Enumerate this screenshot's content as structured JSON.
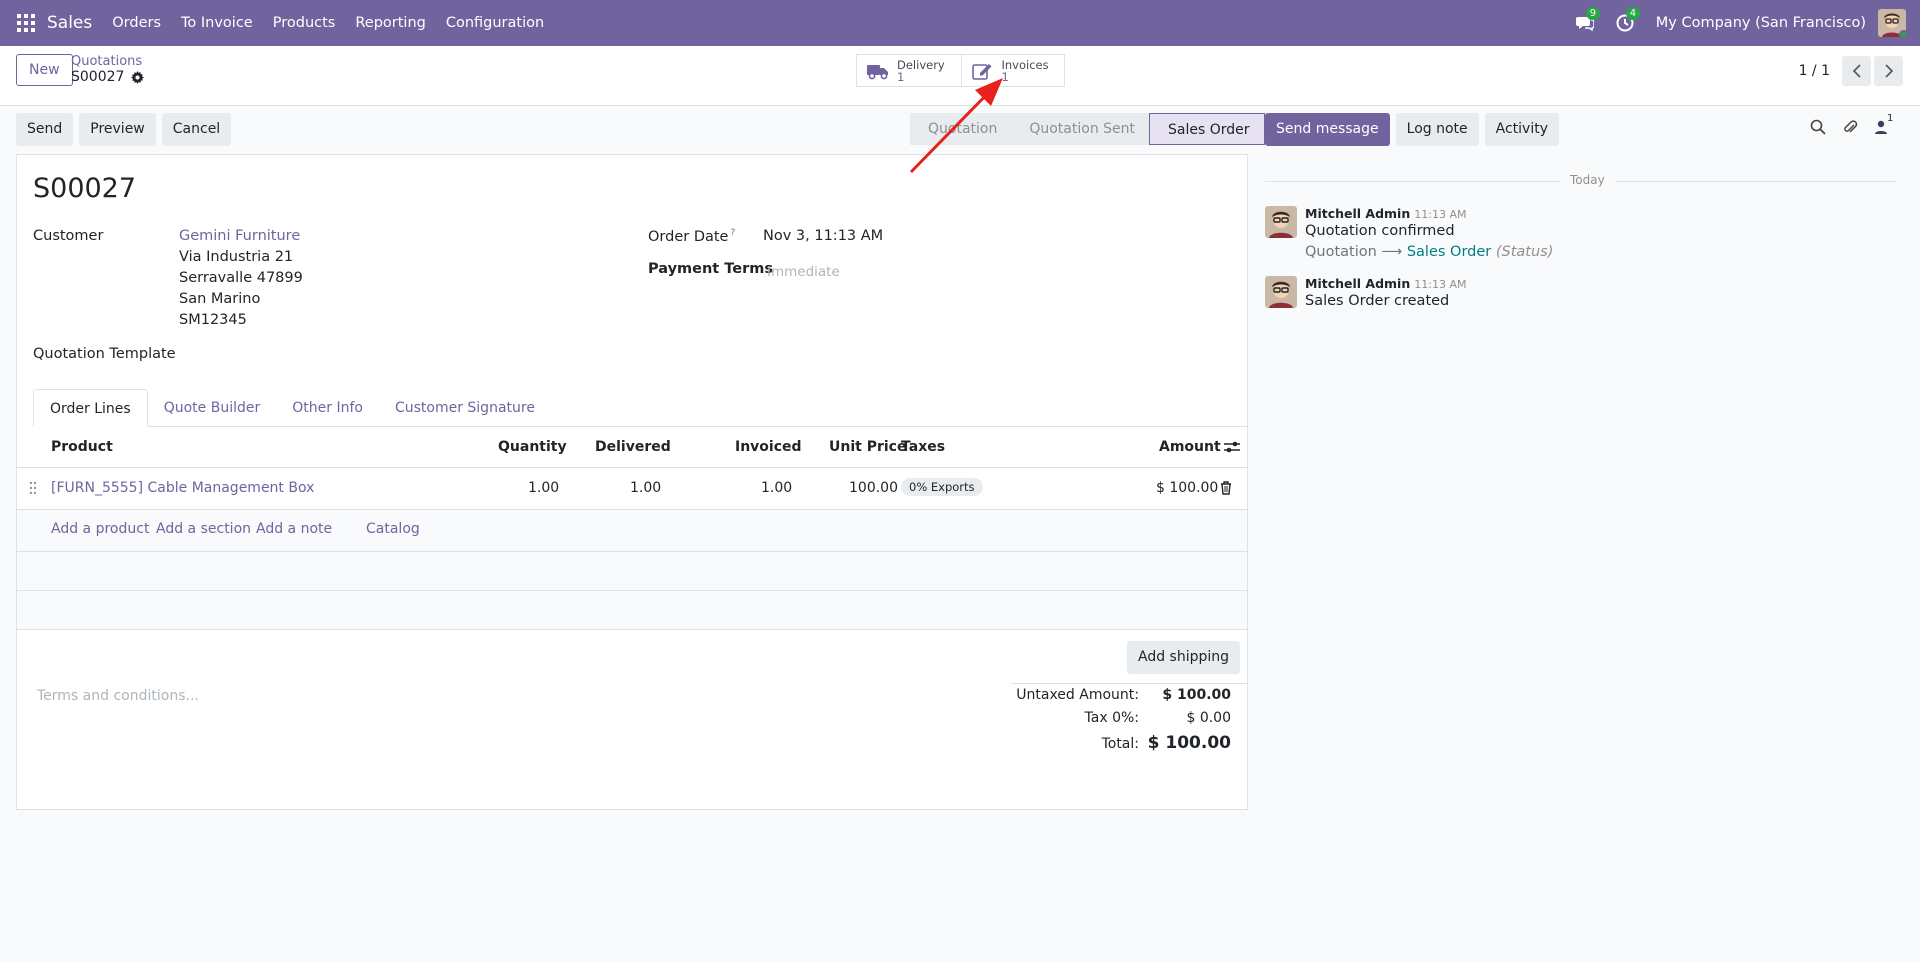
{
  "topbar": {
    "app_name": "Sales",
    "menu": [
      "Orders",
      "To Invoice",
      "Products",
      "Reporting",
      "Configuration"
    ],
    "messages_count": "9",
    "activities_count": "4",
    "company": "My Company (San Francisco)",
    "accent_color": "#71639e"
  },
  "control_panel": {
    "new_label": "New",
    "breadcrumb_parent": "Quotations",
    "breadcrumb_current": "S00027",
    "smart_buttons": [
      {
        "label": "Delivery",
        "count": "1",
        "icon": "truck-icon"
      },
      {
        "label": "Invoices",
        "count": "1",
        "icon": "edit-invoice-icon"
      }
    ],
    "pager": "1 / 1"
  },
  "actions": {
    "send": "Send",
    "preview": "Preview",
    "cancel": "Cancel"
  },
  "statusbar": {
    "stages": [
      "Quotation",
      "Quotation Sent",
      "Sales Order"
    ],
    "active": "Sales Order"
  },
  "chatter_actions": {
    "send_message": "Send message",
    "log_note": "Log note",
    "activity": "Activity",
    "followers_count": "1"
  },
  "form": {
    "title": "S00027",
    "customer_label": "Customer",
    "customer_name": "Gemini Furniture",
    "address": [
      "Via Industria 21",
      "Serravalle 47899",
      "San Marino",
      "SM12345"
    ],
    "quotation_template_label": "Quotation Template",
    "order_date_label": "Order Date",
    "order_date_help": "?",
    "order_date": "Nov 3, 11:13 AM",
    "payment_terms_label": "Payment Terms",
    "payment_terms_placeholder": "Immediate",
    "tabs": [
      "Order Lines",
      "Quote Builder",
      "Other Info",
      "Customer Signature"
    ],
    "columns": {
      "product": "Product",
      "quantity": "Quantity",
      "delivered": "Delivered",
      "invoiced": "Invoiced",
      "unit_price": "Unit Price",
      "taxes": "Taxes",
      "amount": "Amount"
    },
    "lines": [
      {
        "product": "[FURN_5555] Cable Management Box",
        "quantity": "1.00",
        "delivered": "1.00",
        "invoiced": "1.00",
        "unit_price": "100.00",
        "tax": "0% Exports",
        "amount": "$ 100.00"
      }
    ],
    "add_links": [
      "Add a product",
      "Add a section",
      "Add a note",
      "Catalog"
    ],
    "add_shipping": "Add shipping",
    "terms_placeholder": "Terms and conditions...",
    "totals": {
      "untaxed_label": "Untaxed Amount:",
      "untaxed_value": "$ 100.00",
      "tax_label": "Tax 0%:",
      "tax_value": "$ 0.00",
      "total_label": "Total:",
      "total_value": "$ 100.00"
    }
  },
  "chatter": {
    "today_label": "Today",
    "messages": [
      {
        "author": "Mitchell Admin",
        "time": "11:13 AM",
        "body": "Quotation confirmed",
        "tracking_old": "Quotation",
        "tracking_arrow": "⟶",
        "tracking_new": "Sales Order",
        "tracking_field": "(Status)"
      },
      {
        "author": "Mitchell Admin",
        "time": "11:13 AM",
        "body": "Sales Order created"
      }
    ]
  }
}
